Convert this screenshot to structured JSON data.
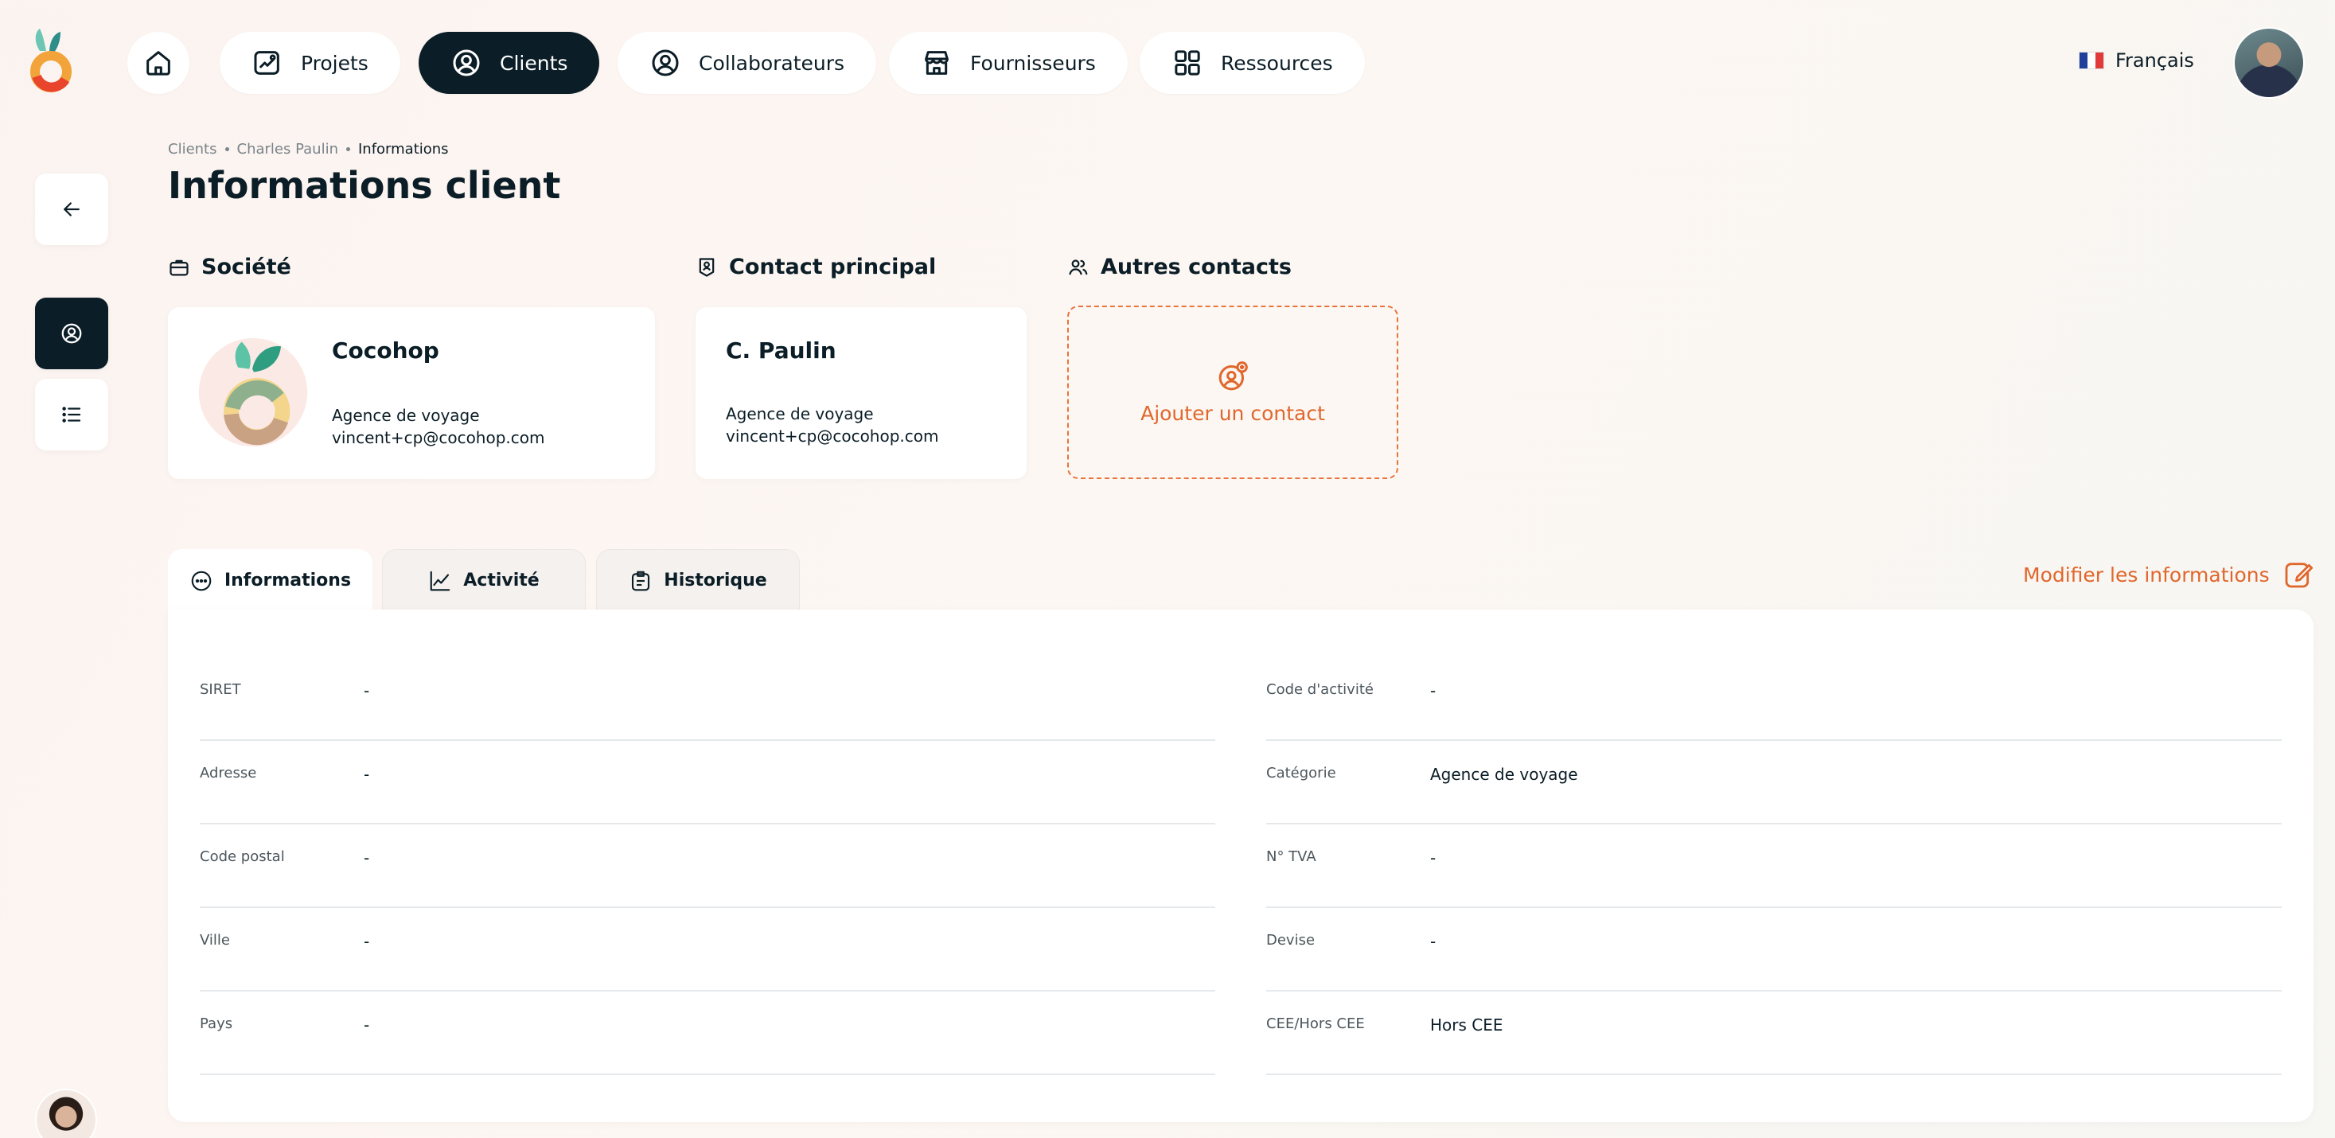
{
  "nav": {
    "items": [
      {
        "label": "Projets"
      },
      {
        "label": "Clients"
      },
      {
        "label": "Collaborateurs"
      },
      {
        "label": "Fournisseurs"
      },
      {
        "label": "Ressources"
      }
    ],
    "language": "Français"
  },
  "breadcrumb": [
    "Clients",
    "Charles Paulin",
    "Informations"
  ],
  "page_title": "Informations client",
  "sections": {
    "societe": "Société",
    "contact_principal": "Contact principal",
    "autres_contacts": "Autres contacts"
  },
  "company": {
    "name": "Cocohop",
    "type": "Agence de voyage",
    "email": "vincent+cp@cocohop.com"
  },
  "contact": {
    "name": "C. Paulin",
    "type": "Agence de voyage",
    "email": "vincent+cp@cocohop.com"
  },
  "add_contact_label": "Ajouter un contact",
  "tabs": [
    {
      "label": "Informations"
    },
    {
      "label": "Activité"
    },
    {
      "label": "Historique"
    }
  ],
  "modify_label": "Modifier les informations",
  "fields_left": [
    {
      "label": "SIRET",
      "value": "-"
    },
    {
      "label": "Adresse",
      "value": "-"
    },
    {
      "label": "Code postal",
      "value": "-"
    },
    {
      "label": "Ville",
      "value": "-"
    },
    {
      "label": "Pays",
      "value": "-"
    }
  ],
  "fields_right": [
    {
      "label": "Code d'activité",
      "value": "-"
    },
    {
      "label": "Catégorie",
      "value": "Agence de voyage"
    },
    {
      "label": "N° TVA",
      "value": "-"
    },
    {
      "label": "Devise",
      "value": "-"
    },
    {
      "label": "CEE/Hors CEE",
      "value": "Hors CEE"
    }
  ],
  "colors": {
    "dark": "#0b1d26",
    "accent": "#e0672c",
    "background": "#fbf3ef"
  }
}
